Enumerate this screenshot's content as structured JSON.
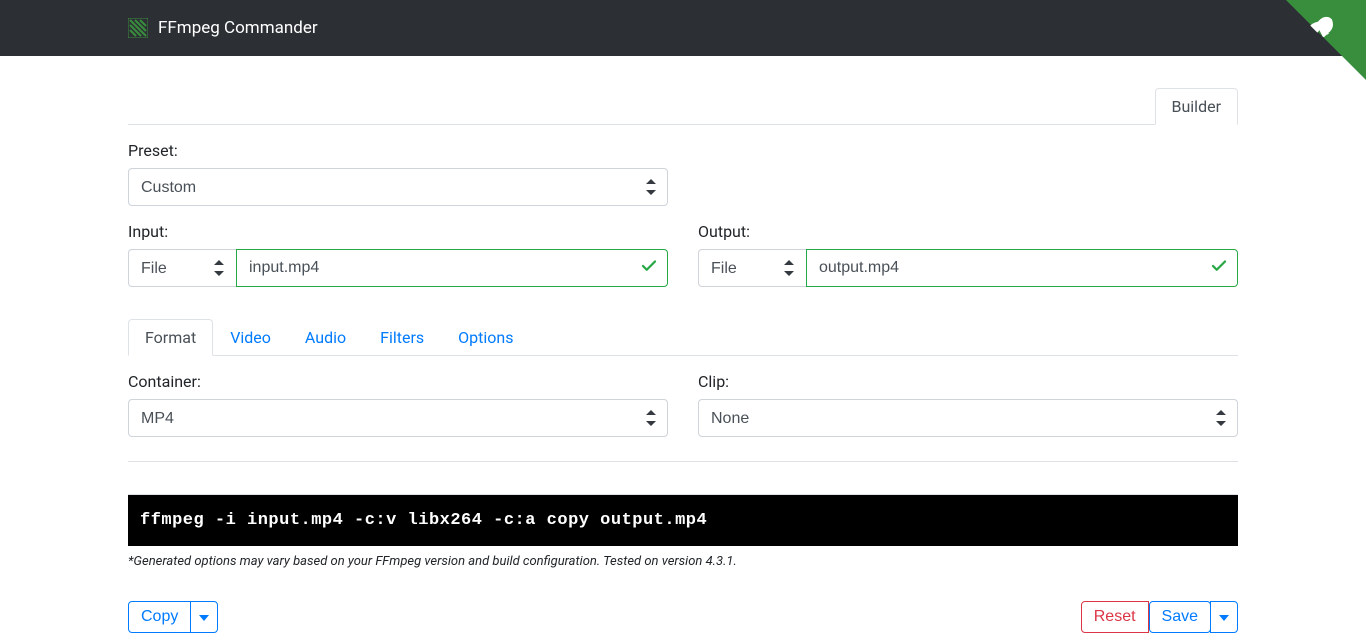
{
  "navbar": {
    "title": "FFmpeg Commander"
  },
  "tabs": {
    "builder": "Builder"
  },
  "preset": {
    "label": "Preset:",
    "value": "Custom"
  },
  "input": {
    "label": "Input:",
    "type": "File",
    "value": "input.mp4"
  },
  "output": {
    "label": "Output:",
    "type": "File",
    "value": "output.mp4"
  },
  "innerTabs": {
    "format": "Format",
    "video": "Video",
    "audio": "Audio",
    "filters": "Filters",
    "options": "Options"
  },
  "container": {
    "label": "Container:",
    "value": "MP4"
  },
  "clip": {
    "label": "Clip:",
    "value": "None"
  },
  "command": "ffmpeg -i input.mp4 -c:v libx264 -c:a copy output.mp4",
  "disclaimer": "*Generated options may vary based on your FFmpeg version and build configuration. Tested on version 4.3.1.",
  "actions": {
    "copy": "Copy",
    "reset": "Reset",
    "save": "Save"
  }
}
